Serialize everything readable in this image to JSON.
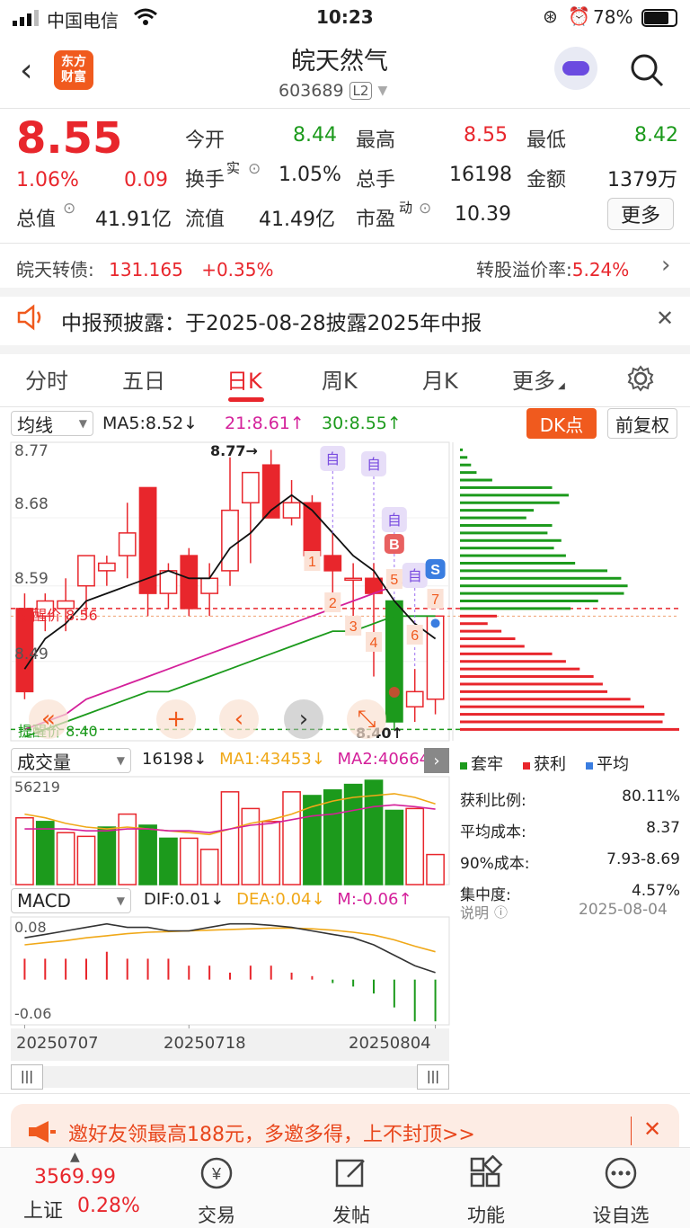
{
  "status_bar": {
    "carrier": "中国电信",
    "time": "10:23",
    "battery": "78%"
  },
  "header": {
    "title": "皖天然气",
    "code": "603689",
    "level": "L2",
    "logo_line1": "东方",
    "logo_line2": "财富"
  },
  "quote": {
    "price": "8.55",
    "change_pct": "1.06%",
    "change": "0.09",
    "open_label": "今开",
    "open": "8.44",
    "high_label": "最高",
    "high": "8.55",
    "low_label": "最低",
    "low": "8.42",
    "turnover_label": "换手",
    "turnover_sup": "实",
    "turnover": "1.05%",
    "volume_label": "总手",
    "volume": "16198",
    "amount_label": "金额",
    "amount": "1379万",
    "mktcap_label": "总值",
    "mktcap": "41.91亿",
    "float_label": "流值",
    "float": "41.49亿",
    "pe_label": "市盈",
    "pe_sup": "动",
    "pe": "10.39",
    "more": "更多"
  },
  "bond": {
    "name_label": "皖天转债:",
    "price": "131.165",
    "change": "+0.35%",
    "premium_label": "转股溢价率:",
    "premium": "5.24%"
  },
  "notice": {
    "text": "中报预披露：于2025-08-28披露2025年中报"
  },
  "tabs": [
    "分时",
    "五日",
    "日K",
    "周K",
    "月K",
    "更多"
  ],
  "active_tab": 2,
  "ma_bar": {
    "select": "均线",
    "ma5": "MA5:8.52↓",
    "ma21": "21:8.61↑",
    "ma30": "30:8.55↑",
    "dk": "DK点",
    "fq": "前复权"
  },
  "kline": {
    "y_ticks": [
      "8.77",
      "8.68",
      "8.59",
      "8.49",
      "8.40"
    ],
    "high_marker": "8.77→",
    "low_marker": "8.40↑",
    "alert_upper": "提醒价 8.56",
    "alert_lower": "提醒价 8.40",
    "tags_zi": [
      "自",
      "自",
      "自",
      "自"
    ],
    "tag_b": "B",
    "tag_s": "S",
    "nums": [
      "1",
      "2",
      "3",
      "4",
      "5",
      "6",
      "7"
    ]
  },
  "chip_legend": {
    "trap": "套牢",
    "profit": "获利",
    "avg": "平均"
  },
  "chip_stats": [
    {
      "label": "获利比例:",
      "value": "80.11%"
    },
    {
      "label": "平均成本:",
      "value": "8.37"
    },
    {
      "label": "90%成本:",
      "value": "7.93-8.69"
    },
    {
      "label": "集中度:",
      "value": "4.57%"
    }
  ],
  "chip_note": {
    "label": "说明",
    "date": "2025-08-04"
  },
  "volume_bar": {
    "select": "成交量",
    "vol": "16198↓",
    "ma1": "MA1:43453↓",
    "ma2": "MA2:40664",
    "max": "56219"
  },
  "macd_bar": {
    "select": "MACD",
    "dif": "DIF:0.01↓",
    "dea": "DEA:0.04↓",
    "m": "M:-0.06↑",
    "top": "0.08",
    "bottom": "-0.06"
  },
  "dates": [
    "20250707",
    "20250718",
    "20250804"
  ],
  "promo": {
    "text": "邀好友领最高188元，多邀多得，上不封顶>>"
  },
  "bottom_nav": {
    "index_value": "3569.99",
    "index_name": "上证",
    "index_change": "0.28%",
    "items": [
      "交易",
      "发帖",
      "功能",
      "设自选"
    ]
  },
  "colors": {
    "up": "#e8262c",
    "down": "#1c9a1c",
    "accent": "#f05a1e"
  },
  "chart_data": {
    "type": "candlestick",
    "candles": [
      {
        "o": 8.56,
        "h": 8.58,
        "l": 8.44,
        "c": 8.45
      },
      {
        "o": 8.55,
        "h": 8.58,
        "l": 8.53,
        "c": 8.57
      },
      {
        "o": 8.56,
        "h": 8.6,
        "l": 8.53,
        "c": 8.57
      },
      {
        "o": 8.59,
        "h": 8.62,
        "l": 8.55,
        "c": 8.63
      },
      {
        "o": 8.61,
        "h": 8.63,
        "l": 8.59,
        "c": 8.62
      },
      {
        "o": 8.63,
        "h": 8.7,
        "l": 8.6,
        "c": 8.66
      },
      {
        "o": 8.72,
        "h": 8.72,
        "l": 8.55,
        "c": 8.58
      },
      {
        "o": 8.58,
        "h": 8.62,
        "l": 8.56,
        "c": 8.61
      },
      {
        "o": 8.63,
        "h": 8.64,
        "l": 8.55,
        "c": 8.56
      },
      {
        "o": 8.58,
        "h": 8.62,
        "l": 8.55,
        "c": 8.6
      },
      {
        "o": 8.61,
        "h": 8.76,
        "l": 8.59,
        "c": 8.69
      },
      {
        "o": 8.7,
        "h": 8.74,
        "l": 8.62,
        "c": 8.74
      },
      {
        "o": 8.75,
        "h": 8.77,
        "l": 8.68,
        "c": 8.68
      },
      {
        "o": 8.68,
        "h": 8.73,
        "l": 8.67,
        "c": 8.7
      },
      {
        "o": 8.7,
        "h": 8.71,
        "l": 8.63,
        "c": 8.63
      },
      {
        "o": 8.63,
        "h": 8.66,
        "l": 8.58,
        "c": 8.61
      },
      {
        "o": 8.6,
        "h": 8.62,
        "l": 8.55,
        "c": 8.6
      },
      {
        "o": 8.6,
        "h": 8.62,
        "l": 8.47,
        "c": 8.58
      },
      {
        "o": 8.57,
        "h": 8.57,
        "l": 8.4,
        "c": 8.41
      },
      {
        "o": 8.43,
        "h": 8.48,
        "l": 8.41,
        "c": 8.45
      },
      {
        "o": 8.44,
        "h": 8.55,
        "l": 8.42,
        "c": 8.55
      }
    ],
    "ma5": [
      8.48,
      8.52,
      8.54,
      8.57,
      8.58,
      8.59,
      8.6,
      8.61,
      8.6,
      8.6,
      8.64,
      8.66,
      8.69,
      8.71,
      8.69,
      8.66,
      8.63,
      8.61,
      8.57,
      8.54,
      8.52
    ],
    "ma21": [
      8.4,
      8.41,
      8.42,
      8.44,
      8.45,
      8.46,
      8.47,
      8.48,
      8.49,
      8.5,
      8.51,
      8.52,
      8.53,
      8.54,
      8.55,
      8.56,
      8.57,
      8.58,
      8.59,
      8.6,
      8.61
    ],
    "ma30": [
      8.39,
      8.4,
      8.41,
      8.42,
      8.43,
      8.44,
      8.45,
      8.45,
      8.46,
      8.47,
      8.48,
      8.49,
      8.5,
      8.51,
      8.52,
      8.53,
      8.53,
      8.54,
      8.55,
      8.55,
      8.55
    ],
    "volume": [
      36000,
      34000,
      28000,
      26000,
      31000,
      38000,
      32000,
      25000,
      25000,
      19000,
      50000,
      41000,
      34000,
      50000,
      48000,
      51000,
      54000,
      56219,
      40000,
      41000,
      16198
    ],
    "vol_ma1": [
      38000,
      36000,
      33000,
      31000,
      30000,
      31000,
      30000,
      29000,
      28000,
      27000,
      30000,
      33000,
      35000,
      38000,
      42000,
      45000,
      47000,
      48000,
      49000,
      47000,
      43453
    ],
    "vol_ma2": [
      30000,
      30000,
      30000,
      29000,
      29000,
      30000,
      30000,
      29000,
      29000,
      28000,
      30000,
      32000,
      33000,
      35000,
      37000,
      38000,
      40000,
      42000,
      43000,
      42000,
      40664
    ],
    "macd_hist": [
      0.03,
      0.03,
      0.03,
      0.03,
      0.04,
      0.03,
      0.03,
      0.03,
      0.02,
      0.02,
      0.01,
      0.02,
      0.02,
      0.01,
      0.005,
      -0.005,
      -0.01,
      -0.02,
      -0.04,
      -0.06,
      -0.06
    ],
    "dif": [
      0.06,
      0.065,
      0.07,
      0.075,
      0.08,
      0.075,
      0.075,
      0.07,
      0.07,
      0.075,
      0.08,
      0.08,
      0.078,
      0.075,
      0.07,
      0.065,
      0.06,
      0.05,
      0.035,
      0.02,
      0.01
    ],
    "dea": [
      0.05,
      0.053,
      0.056,
      0.06,
      0.063,
      0.066,
      0.068,
      0.069,
      0.07,
      0.071,
      0.072,
      0.073,
      0.074,
      0.074,
      0.073,
      0.071,
      0.068,
      0.064,
      0.057,
      0.048,
      0.04
    ],
    "chips": [
      {
        "p": 8.77,
        "v": 3
      },
      {
        "p": 8.76,
        "v": 8
      },
      {
        "p": 8.75,
        "v": 12
      },
      {
        "p": 8.74,
        "v": 18
      },
      {
        "p": 8.73,
        "v": 35
      },
      {
        "p": 8.72,
        "v": 100
      },
      {
        "p": 8.71,
        "v": 118
      },
      {
        "p": 8.7,
        "v": 108
      },
      {
        "p": 8.69,
        "v": 80
      },
      {
        "p": 8.68,
        "v": 72
      },
      {
        "p": 8.67,
        "v": 100
      },
      {
        "p": 8.66,
        "v": 95
      },
      {
        "p": 8.65,
        "v": 110
      },
      {
        "p": 8.64,
        "v": 102
      },
      {
        "p": 8.63,
        "v": 115
      },
      {
        "p": 8.62,
        "v": 125
      },
      {
        "p": 8.61,
        "v": 160
      },
      {
        "p": 8.6,
        "v": 175
      },
      {
        "p": 8.59,
        "v": 182
      },
      {
        "p": 8.58,
        "v": 178
      },
      {
        "p": 8.57,
        "v": 150
      },
      {
        "p": 8.56,
        "v": 120
      },
      {
        "p": 8.55,
        "v": 40
      },
      {
        "p": 8.54,
        "v": 30
      },
      {
        "p": 8.53,
        "v": 45
      },
      {
        "p": 8.52,
        "v": 60
      },
      {
        "p": 8.51,
        "v": 70
      },
      {
        "p": 8.5,
        "v": 100
      },
      {
        "p": 8.49,
        "v": 115
      },
      {
        "p": 8.48,
        "v": 130
      },
      {
        "p": 8.47,
        "v": 145
      },
      {
        "p": 8.46,
        "v": 155
      },
      {
        "p": 8.45,
        "v": 160
      },
      {
        "p": 8.44,
        "v": 185
      },
      {
        "p": 8.43,
        "v": 200
      },
      {
        "p": 8.42,
        "v": 222
      },
      {
        "p": 8.41,
        "v": 220
      },
      {
        "p": 8.4,
        "v": 238
      }
    ]
  }
}
